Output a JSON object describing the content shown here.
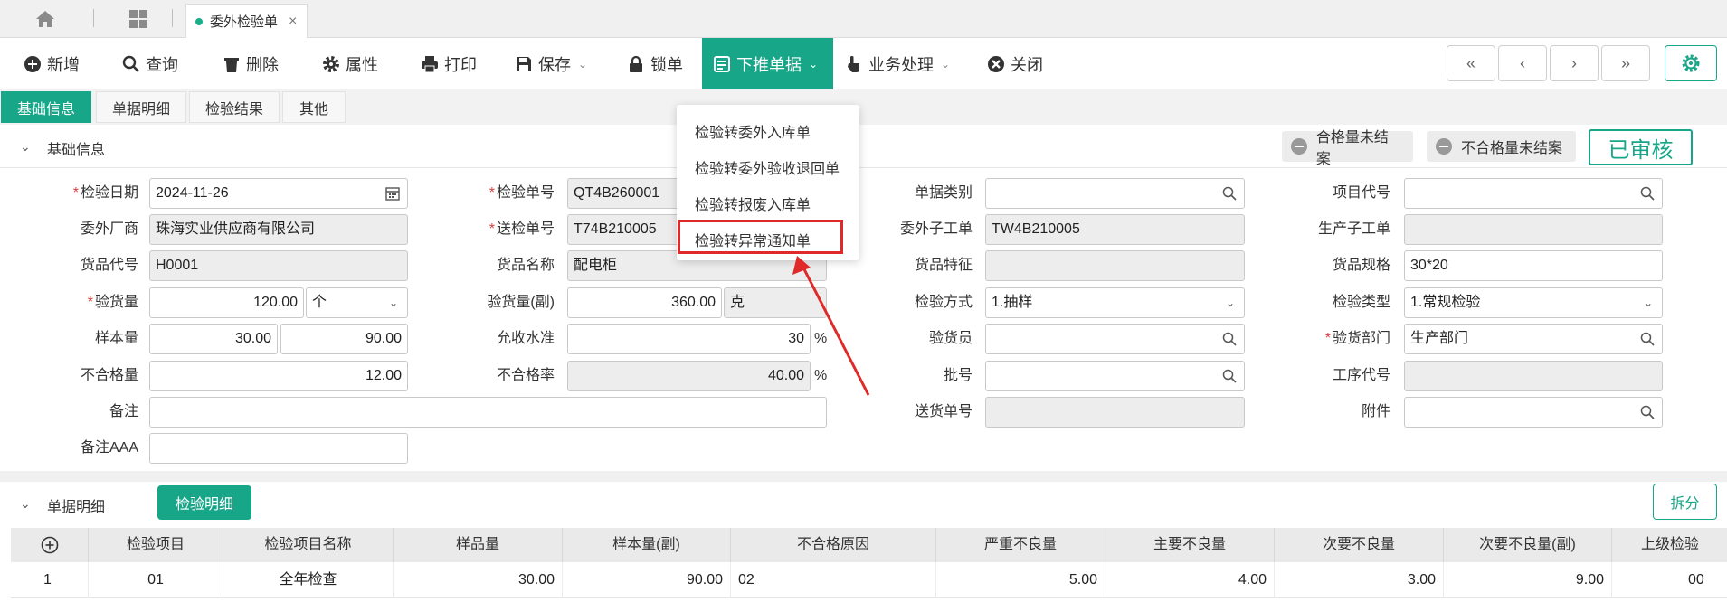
{
  "tabstrip": {
    "doc_tab_label": "委外检验单",
    "close_glyph": "×"
  },
  "toolbar": {
    "new": "新增",
    "query": "查询",
    "delete": "删除",
    "properties": "属性",
    "print": "打印",
    "save": "保存",
    "lock": "锁单",
    "push_down": "下推单据",
    "business": "业务处理",
    "close": "关闭",
    "first": "«",
    "prev": "‹",
    "next": "›",
    "last": "»"
  },
  "section_tabs": [
    "基础信息",
    "单据明细",
    "检验结果",
    "其他"
  ],
  "basic_section": {
    "title": "基础信息",
    "pill_qualified": "合格量未结案",
    "pill_unqualified": "不合格量未结案",
    "status": "已审核"
  },
  "form": {
    "inspect_date_label": "检验日期",
    "inspect_date": "2024-11-26",
    "inspect_no_label": "检验单号",
    "inspect_no": "QT4B260001",
    "bill_type_label": "单据类别",
    "bill_type": "",
    "project_code_label": "项目代号",
    "project_code": "",
    "vendor_label": "委外厂商",
    "vendor": "珠海实业供应商有限公司",
    "send_no_label": "送检单号",
    "send_no": "T74B210005",
    "sub_order_label": "委外子工单",
    "sub_order": "TW4B210005",
    "prod_sub_order_label": "生产子工单",
    "prod_sub_order": "",
    "item_code_label": "货品代号",
    "item_code": "H0001",
    "item_name_label": "货品名称",
    "item_name": "配电柜",
    "item_feature_label": "货品特征",
    "item_feature": "",
    "item_spec_label": "货品规格",
    "item_spec": "30*20",
    "qty_label": "验货量",
    "qty": "120.00",
    "qty_unit": "个",
    "qty_sub_label": "验货量(副)",
    "qty_sub": "360.00",
    "qty_sub_unit": "克",
    "method_label": "检验方式",
    "method": "1.抽样",
    "type_label": "检验类型",
    "type": "1.常规检验",
    "sample_label": "样本量",
    "sample1": "30.00",
    "sample2": "90.00",
    "accept_label": "允收水准",
    "accept": "30",
    "pct": "%",
    "inspector_label": "验货员",
    "inspector": "",
    "dept_label": "验货部门",
    "dept": "生产部门",
    "bad_qty_label": "不合格量",
    "bad_qty": "12.00",
    "bad_rate_label": "不合格率",
    "bad_rate": "40.00",
    "batch_label": "批号",
    "batch": "",
    "process_label": "工序代号",
    "process": "",
    "remark_label": "备注",
    "remark": "",
    "delivery_label": "送货单号",
    "delivery": "",
    "attach_label": "附件",
    "attach": "",
    "remark_aaa_label": "备注AAA",
    "remark_aaa": ""
  },
  "menu": {
    "items": [
      "检验转委外入库单",
      "检验转委外验收退回单",
      "检验转报废入库单",
      "检验转异常通知单"
    ]
  },
  "detail_section": {
    "title": "单据明细",
    "tab": "检验明细",
    "split": "拆分",
    "columns": [
      "检验项目",
      "检验项目名称",
      "样品量",
      "样本量(副)",
      "不合格原因",
      "严重不良量",
      "主要不良量",
      "次要不良量",
      "次要不良量(副)",
      "上级检验"
    ],
    "row": {
      "index": "1",
      "code": "01",
      "name": "全年检查",
      "sample": "30.00",
      "sample_sub": "90.00",
      "reason": "02",
      "severe": "5.00",
      "major": "4.00",
      "minor": "3.00",
      "minor_sub": "9.00",
      "upper": "00"
    }
  },
  "colors": {
    "accent": "#18a689",
    "required": "#e03c3c",
    "highlight": "#e02a2a"
  }
}
